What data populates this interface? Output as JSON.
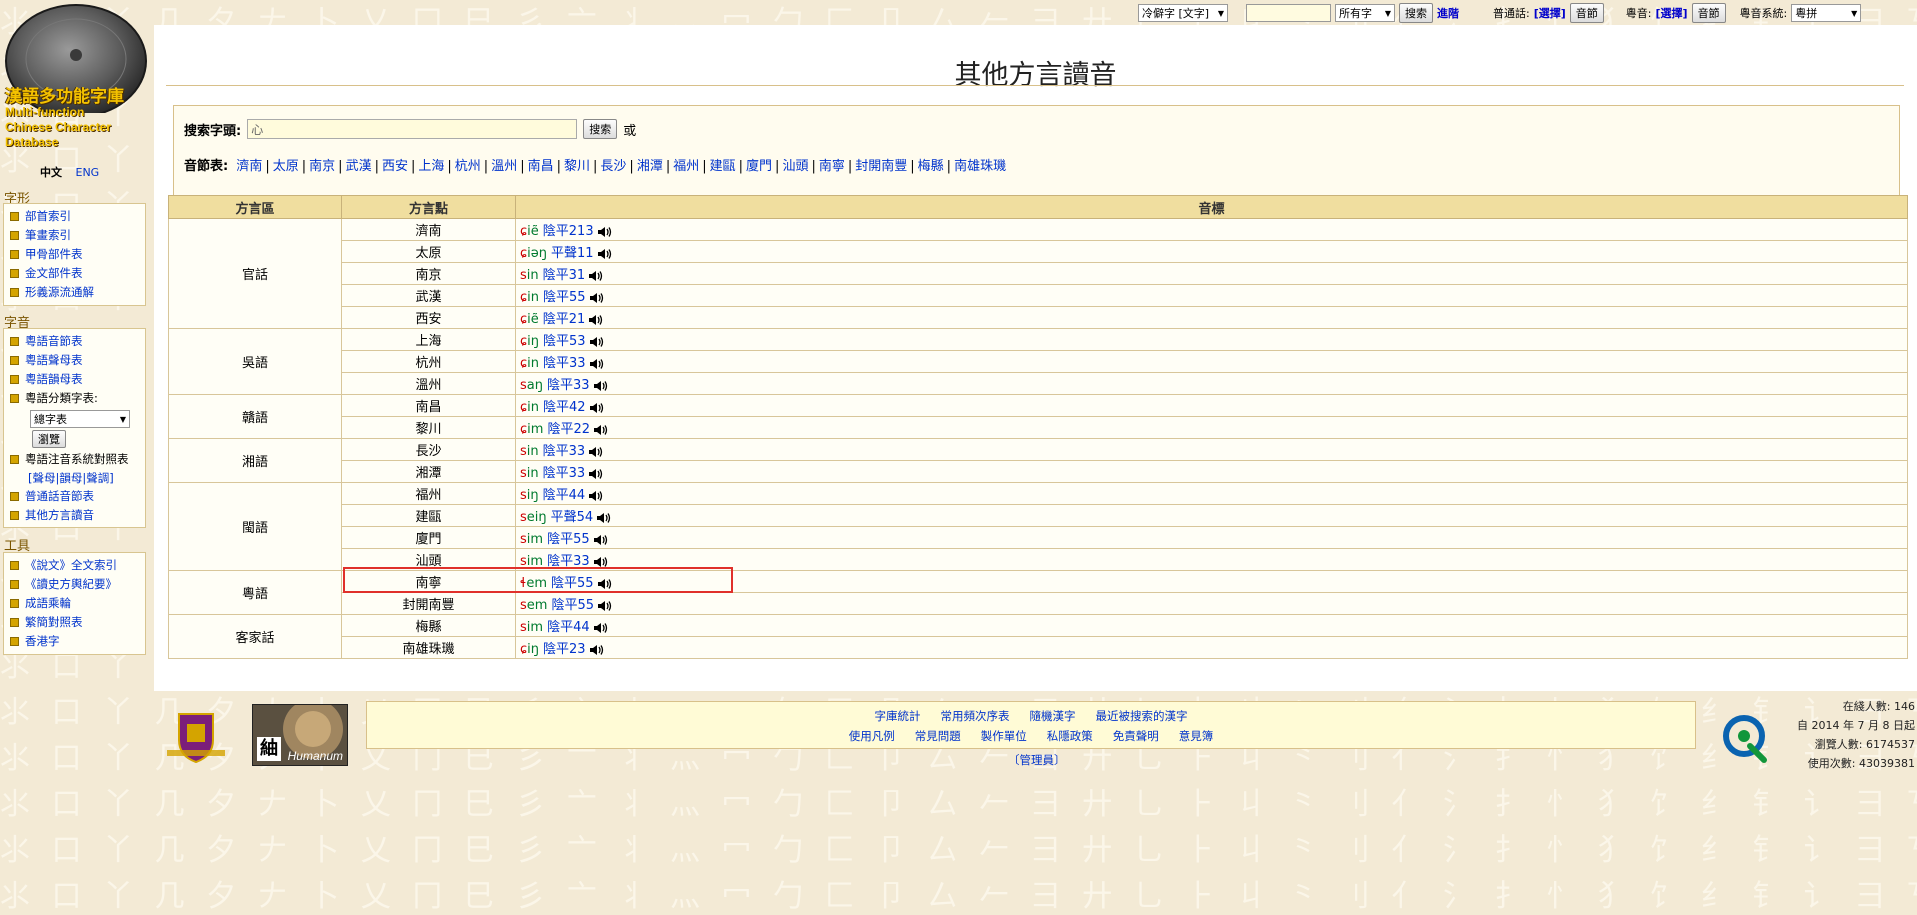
{
  "topbar": {
    "font_select": "冷僻字 [文字]",
    "search_value": "",
    "scope_select": "所有字",
    "search_btn": "搜索",
    "advanced_link": "進階",
    "mandarin_label": "普通話:",
    "mandarin_link": "[選擇]",
    "mandarin_btn": "音節",
    "cantonese_label": "粵音:",
    "cantonese_link": "[選擇]",
    "cantonese_btn": "音節",
    "system_label": "粵音系統:",
    "system_select": "粵拼"
  },
  "logo": {
    "title": "漢語多功能字庫",
    "en_line1": "Multi-function",
    "en_line2": "Chinese Character",
    "en_line3": "Database"
  },
  "lang": {
    "zh": "中文",
    "en": "ENG"
  },
  "nav": {
    "shape_title": "字形",
    "shape_items": [
      "部首索引",
      "筆畫索引",
      "甲骨部件表",
      "金文部件表",
      "形義源流通解"
    ],
    "sound_title": "字音",
    "sound_items": [
      "粵語音節表",
      "粵語聲母表",
      "粵語韻母表"
    ],
    "classify_label": "粵語分類字表:",
    "classify_select": "總字表",
    "browse_btn": "瀏覽",
    "compare_label": "粵語注音系統對照表",
    "compare_sub": "[聲母|韻母|聲調]",
    "sound_items2": [
      "普通話音節表",
      "其他方言讀音"
    ],
    "tools_title": "工具",
    "tools_items": [
      "《說文》全文索引",
      "《讀史方輿紀要》",
      "成語乘輪",
      "繁簡對照表",
      "香港字"
    ]
  },
  "main": {
    "title": "其他方言讀音",
    "search_label": "搜索字頭:",
    "search_value": "心",
    "search_btn": "搜索",
    "or_text": "或",
    "syllable_label": "音節表:",
    "syllable_links": [
      "濟南",
      "太原",
      "南京",
      "武漢",
      "西安",
      "上海",
      "杭州",
      "溫州",
      "南昌",
      "黎川",
      "長沙",
      "湘潭",
      "福州",
      "建甌",
      "廈門",
      "汕頭",
      "南寧",
      "封開南豐",
      "梅縣",
      "南雄珠璣"
    ]
  },
  "table": {
    "headers": [
      "方言區",
      "方言點",
      "音標"
    ],
    "groups": [
      {
        "region": "官話",
        "rows": [
          {
            "point": "濟南",
            "initial": "ɕ",
            "rime": "iẽ",
            "tone": "陰平213"
          },
          {
            "point": "太原",
            "initial": "ɕ",
            "rime": "iəŋ",
            "tone": "平聲11"
          },
          {
            "point": "南京",
            "initial": "s",
            "rime": "in",
            "tone": "陰平31"
          },
          {
            "point": "武漢",
            "initial": "ɕ",
            "rime": "in",
            "tone": "陰平55"
          },
          {
            "point": "西安",
            "initial": "ɕ",
            "rime": "iẽ",
            "tone": "陰平21"
          }
        ]
      },
      {
        "region": "吳語",
        "rows": [
          {
            "point": "上海",
            "initial": "ɕ",
            "rime": "iŋ",
            "tone": "陰平53"
          },
          {
            "point": "杭州",
            "initial": "ɕ",
            "rime": "in",
            "tone": "陰平33"
          },
          {
            "point": "溫州",
            "initial": "s",
            "rime": "aŋ",
            "tone": "陰平33"
          }
        ]
      },
      {
        "region": "贛語",
        "rows": [
          {
            "point": "南昌",
            "initial": "ɕ",
            "rime": "in",
            "tone": "陰平42"
          },
          {
            "point": "黎川",
            "initial": "ɕ",
            "rime": "im",
            "tone": "陰平22"
          }
        ]
      },
      {
        "region": "湘語",
        "rows": [
          {
            "point": "長沙",
            "initial": "s",
            "rime": "in",
            "tone": "陰平33"
          },
          {
            "point": "湘潭",
            "initial": "s",
            "rime": "in",
            "tone": "陰平33"
          }
        ]
      },
      {
        "region": "閩語",
        "rows": [
          {
            "point": "福州",
            "initial": "s",
            "rime": "iŋ",
            "tone": "陰平44"
          },
          {
            "point": "建甌",
            "initial": "s",
            "rime": "eiŋ",
            "tone": "平聲54"
          },
          {
            "point": "廈門",
            "initial": "s",
            "rime": "im",
            "tone": "陰平55"
          },
          {
            "point": "汕頭",
            "initial": "s",
            "rime": "im",
            "tone": "陰平33"
          }
        ]
      },
      {
        "region": "粵語",
        "rows": [
          {
            "point": "南寧",
            "initial": "ɬ",
            "rime": "em",
            "tone": "陰平55"
          },
          {
            "point": "封開南豐",
            "initial": "s",
            "rime": "em",
            "tone": "陰平55"
          }
        ]
      },
      {
        "region": "客家話",
        "rows": [
          {
            "point": "梅縣",
            "initial": "s",
            "rime": "im",
            "tone": "陰平44"
          },
          {
            "point": "南雄珠璣",
            "initial": "ɕ",
            "rime": "iŋ",
            "tone": "陰平23"
          }
        ]
      }
    ]
  },
  "footer": {
    "row1": [
      "字庫統計",
      "常用頻次序表",
      "隨機漢字",
      "最近被搜索的漢字"
    ],
    "row2": [
      "使用凡例",
      "常見問題",
      "製作單位",
      "私隱政策",
      "免責聲明",
      "意見簿"
    ],
    "admin": "〔管理員〕",
    "humanum_text": "Humanum",
    "humanum_char": "紬"
  },
  "stats": {
    "online": "在綫人數: 146",
    "since": "自 2014 年 7 月 8 日起",
    "visitors": "瀏覽人數: 6174537",
    "uses": "使用次數: 43039381"
  }
}
